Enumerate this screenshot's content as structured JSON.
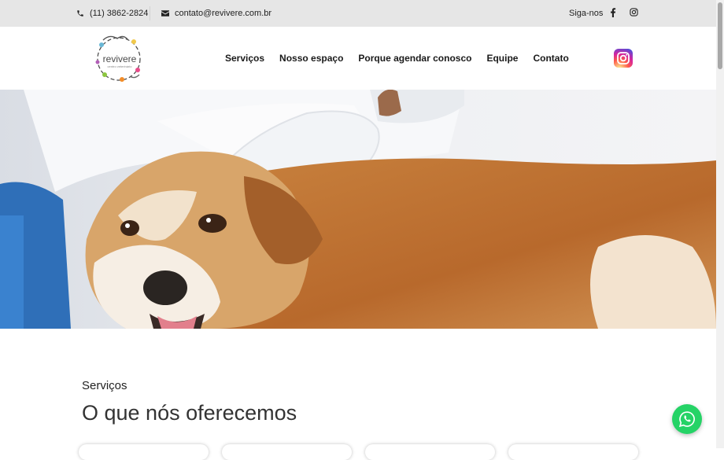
{
  "topbar": {
    "phone": "(11) 3862-2824",
    "email": "contato@revivere.com.br",
    "follow_label": "Siga-nos",
    "icons": {
      "phone": "phone-icon",
      "email": "envelope-icon",
      "facebook": "facebook-icon",
      "instagram": "instagram-icon"
    }
  },
  "navbar": {
    "logo_name": "revivere",
    "logo_tag": "centro veterinário",
    "menu": [
      "Serviços",
      "Nosso espaço",
      "Porque agendar conosco",
      "Equipe",
      "Contato"
    ]
  },
  "hero": {
    "image": "veterinarian-examining-dog"
  },
  "services": {
    "label": "Serviços",
    "title": "O que nós oferecemos",
    "card_count": 4
  },
  "whatsapp": {
    "icon": "whatsapp-icon",
    "color": "#25d366"
  },
  "colors": {
    "topbar_bg": "#e6e6e6",
    "text": "#222222",
    "whatsapp": "#25d366"
  }
}
